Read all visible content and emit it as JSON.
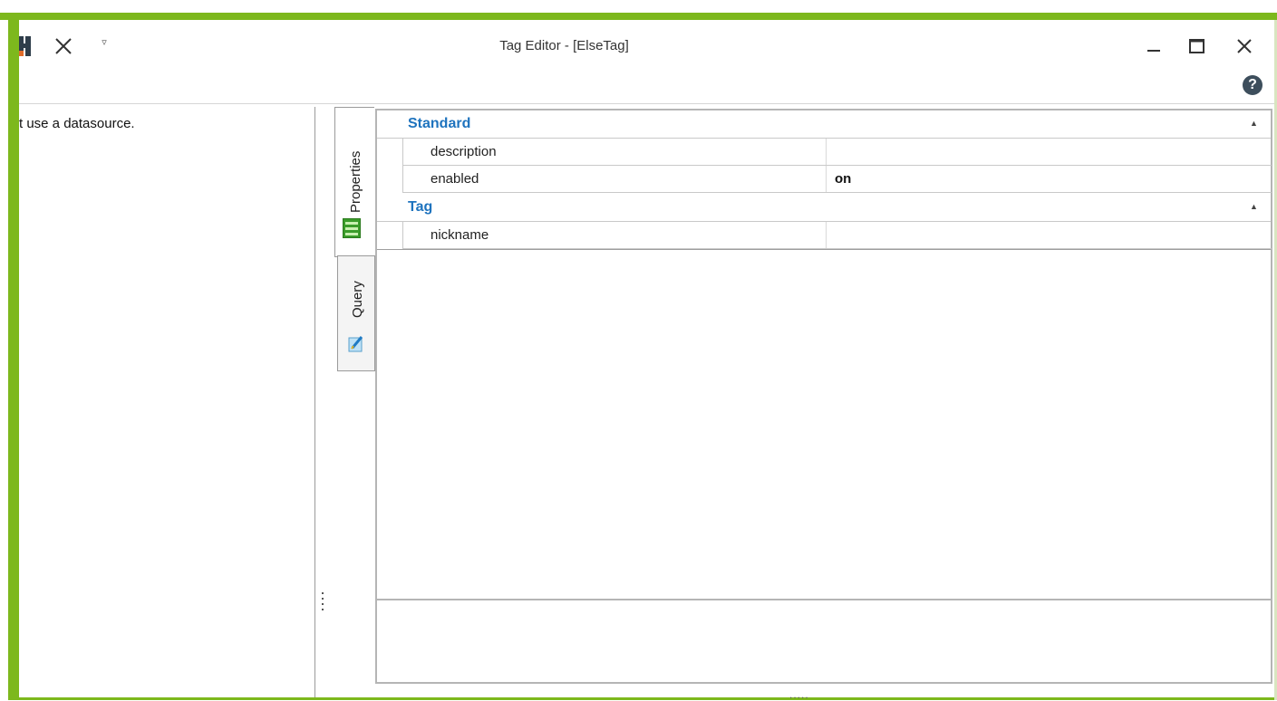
{
  "window": {
    "title": "Tag Editor - [ElseTag]",
    "accent_color": "#7db81d"
  },
  "toolbar": {
    "save_icon": "save-icon",
    "close_icon": "close-icon",
    "dropdown_icon": "chevron-down-icon",
    "dropdown_glyph": "▿"
  },
  "window_controls": {
    "minimize_glyph": "–",
    "maximize_glyph": "☐",
    "close_glyph": "✕",
    "help_glyph": "?"
  },
  "left_panel": {
    "text": "t use a datasource."
  },
  "tabs": [
    {
      "label": "Properties",
      "icon": "properties-icon",
      "selected": true
    },
    {
      "label": "Query",
      "icon": "query-icon",
      "selected": false
    }
  ],
  "property_grid": {
    "categories": [
      {
        "label": "Standard",
        "collapse_glyph": "▲",
        "rows": [
          {
            "name": "description",
            "value": ""
          },
          {
            "name": "enabled",
            "value": "on"
          }
        ]
      },
      {
        "label": "Tag",
        "collapse_glyph": "▲",
        "rows": [
          {
            "name": "nickname",
            "value": ""
          }
        ]
      }
    ]
  },
  "grip": "....."
}
